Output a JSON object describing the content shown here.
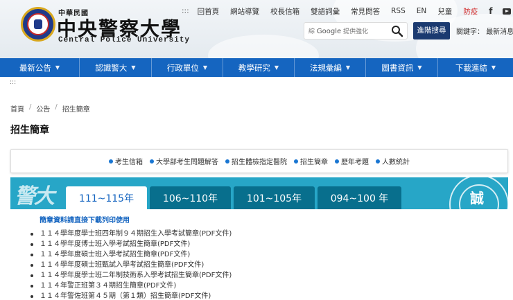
{
  "header": {
    "title_small": "中華民國",
    "title_big": "中央警察大學",
    "title_en": "Central Police University",
    "logo_icon": "cpu-emblem-logo"
  },
  "topnav": {
    "items": [
      "回首頁",
      "網站導覽",
      "校長信箱",
      "雙語詞彙",
      "常見問答",
      "RSS",
      "EN",
      "兒童",
      "防疫"
    ],
    "accessibility": ":::",
    "social": [
      "f"
    ]
  },
  "search": {
    "google_label": "Google",
    "prefix": "綜",
    "provider": "提供強化",
    "advanced_label": "進階搜尋",
    "keywords_label": "關鍵字：",
    "keywords_value": "最新消息"
  },
  "mainnav": {
    "items": [
      "最新公告",
      "認識警大",
      "行政單位",
      "教學研究",
      "法規彙編",
      "圖書資訊",
      "下載連結"
    ]
  },
  "accessibility_row": ":::",
  "breadcrumb": [
    "首頁",
    "公告",
    "招生簡章"
  ],
  "page_title": "招生簡章",
  "quick_links": [
    "考生信箱",
    "大學部考生問題解答",
    "招生體檢指定醫院",
    "招生簡章",
    "歷年考題",
    "人數統計"
  ],
  "banner": {
    "calligraphy": "警大",
    "emblem_text": "誠"
  },
  "tabs": [
    "111~115年",
    "106~110年",
    "101~105年",
    "094~100 年"
  ],
  "active_tab": 0,
  "download_note": "簡章資料請直接下載列印使用",
  "documents": [
    "１１４學年度學士班四年制９４期招生入學考試簡章(PDF文件)",
    "１１４學年度博士班入學考試招生簡章(PDF文件)",
    "１１４學年度碩士班入學考試招生簡章(PDF文件)",
    "１１４學年度碩士班甄試入學考試招生簡章(PDF文件)",
    "１１４學年度學士班二年制技術系入學考試招生簡章(PDF文件)",
    "１１４年警正班第３４期招生簡章(PDF文件)",
    "１１４年警佐班第４５期（第１類）招生簡章(PDF文件)"
  ],
  "colors": {
    "nav_blue": "#1565c0",
    "banner_teal": "#27a6c7",
    "tab_dark": "#086f8d",
    "button_navy": "#1b3a70",
    "alert_red": "#d32f2f"
  }
}
